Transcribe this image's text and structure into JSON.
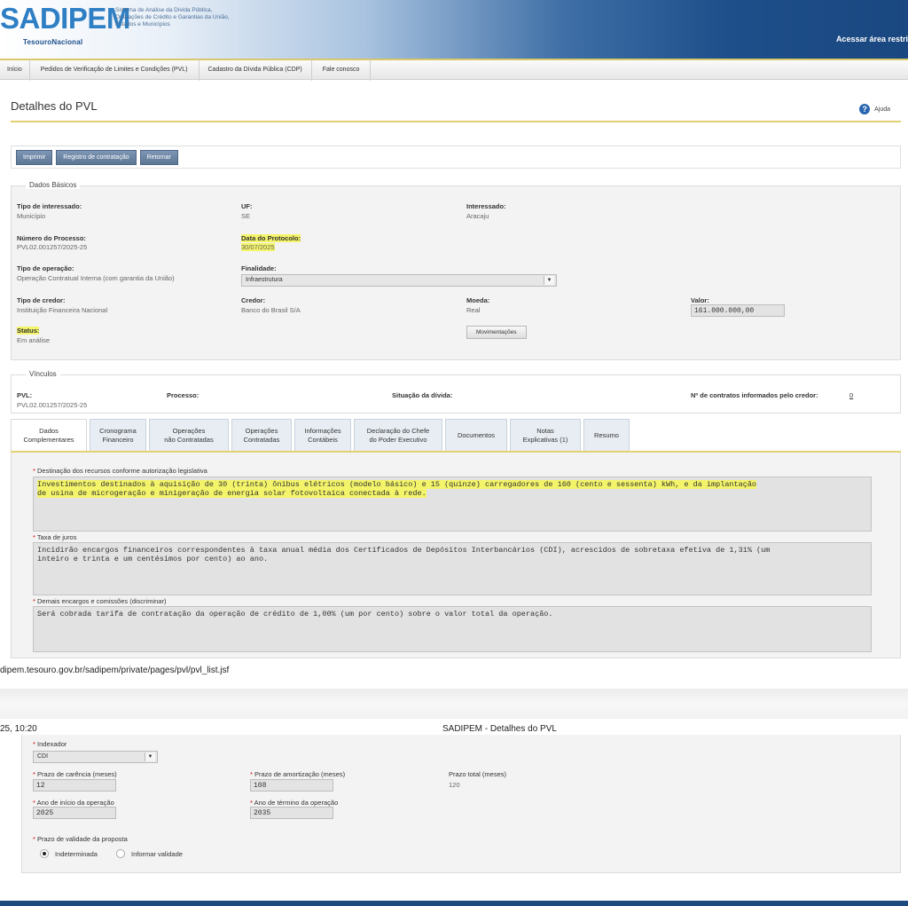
{
  "header": {
    "logo": "SADIPEM",
    "logo_sub": "TesouroNacional",
    "logo_desc": "Sistema de Análise da Dívida Pública, Operações de Crédito e Garantias da União, Estados e Municípios",
    "acessar": "Acessar área restri"
  },
  "menu": [
    "Início",
    "Pedidos de Verificação de Limites e Condições (PVL)",
    "Cadastro da Dívida Pública (CDP)",
    "Fale conosco"
  ],
  "page": {
    "title": "Detalhes do PVL",
    "help": "Ajuda"
  },
  "toolbar": {
    "imprimir": "Imprimir",
    "registro": "Registro de contratação",
    "retornar": "Retornar"
  },
  "dados_basicos": {
    "legend": "Dados Básicos",
    "tipo_interessado_label": "Tipo de interessado:",
    "tipo_interessado": "Município",
    "uf_label": "UF:",
    "uf": "SE",
    "interessado_label": "Interessado:",
    "interessado": "Aracaju",
    "numero_processo_label": "Número do Processo:",
    "numero_processo": "PVL02.001257/2025-25",
    "data_protocolo_label": "Data do Protocolo:",
    "data_protocolo": "30/07/2025",
    "tipo_operacao_label": "Tipo de operação:",
    "tipo_operacao": "Operação Contratual Interna (com garantia da União)",
    "finalidade_label": "Finalidade:",
    "finalidade": "Infraestrutura",
    "tipo_credor_label": "Tipo de credor:",
    "tipo_credor": "Instituição Financeira Nacional",
    "credor_label": "Credor:",
    "credor": "Banco do Brasil S/A",
    "moeda_label": "Moeda:",
    "moeda": "Real",
    "valor_label": "Valor:",
    "valor": "161.000.000,00",
    "status_label": "Status:",
    "status": "Em análise",
    "movimentacoes": "Movimentações"
  },
  "vinculos": {
    "legend": "Vínculos",
    "pvl_label": "PVL:",
    "pvl": "PVL02.001257/2025-25",
    "processo_label": "Processo:",
    "situacao_label": "Situação da dívida:",
    "contratos_label": "Nº de contratos informados pelo credor:",
    "contratos": "0"
  },
  "tabs": [
    {
      "l1": "Dados",
      "l2": "Complementares"
    },
    {
      "l1": "Cronograma",
      "l2": "Financeiro"
    },
    {
      "l1": "Operações",
      "l2": "não Contratadas"
    },
    {
      "l1": "Operações",
      "l2": "Contratadas"
    },
    {
      "l1": "Informações",
      "l2": "Contábeis"
    },
    {
      "l1": "Declaração do Chefe",
      "l2": "do Poder Executivo"
    },
    {
      "l1": "Documentos",
      "l2": ""
    },
    {
      "l1": "Notas",
      "l2": "Explicativas (1)"
    },
    {
      "l1": "Resumo",
      "l2": ""
    }
  ],
  "complementares": {
    "destinacao_label": "Destinação dos recursos conforme autorização legislativa",
    "destinacao_l1": "Investimentos destinados à aquisição de 30 (trinta) ônibus elétricos (modelo básico) e 15 (quinze) carregadores de 160 (cento e sessenta) kWh, e da implantação",
    "destinacao_l2": "de usina de microgeração e minigeração de energia solar fotovoltaica conectada à rede.",
    "taxa_label": "Taxa de juros",
    "taxa_l1": "Incidirão encargos financeiros correspondentes à taxa anual média dos Certificados de Depósitos Interbancários (CDI), acrescidos de sobretaxa efetiva de 1,31% (um",
    "taxa_l2": "inteiro e trinta e um centésimos por cento) ao ano.",
    "demais_label": "Demais encargos e comissões (discriminar)",
    "demais": "Será cobrada tarifa de contratação da operação de crédito de 1,00% (um por cento) sobre o valor total da operação.",
    "indexador_label": "Indexador",
    "indexador": "CDI",
    "carencia_label": "Prazo de carência (meses)",
    "carencia": "12",
    "amortizacao_label": "Prazo de amortização (meses)",
    "amortizacao": "108",
    "prazo_total_label": "Prazo total (meses)",
    "prazo_total": "120",
    "ano_inicio_label": "Ano de início da operação",
    "ano_inicio": "2025",
    "ano_termino_label": "Ano de término da operação",
    "ano_termino": "2035",
    "validade_label": "Prazo de validade da proposta",
    "opt_indeterminada": "Indeterminada",
    "opt_informar": "Informar validade"
  },
  "print": {
    "url": "dipem.tesouro.gov.br/sadipem/private/pages/pvl/pvl_list.jsf",
    "datetime": "25, 10:20",
    "doc_title": "SADIPEM - Detalhes do PVL"
  }
}
